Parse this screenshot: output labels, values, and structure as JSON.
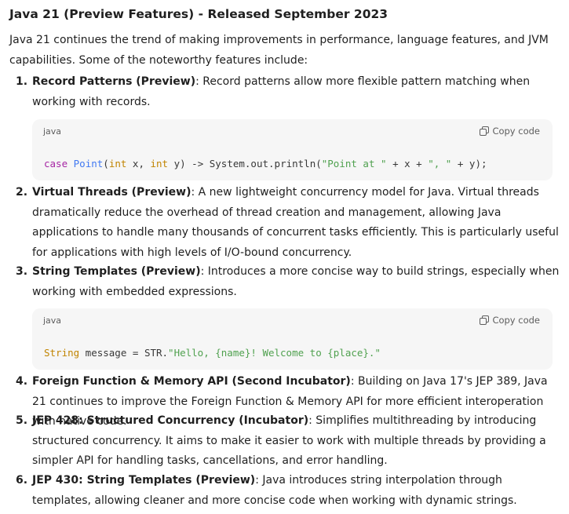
{
  "title": "Java 21 (Preview Features) - Released September 2023",
  "intro": "Java 21 continues the trend of making improvements in performance, language features, and JVM capabilities. Some of the noteworthy features include:",
  "items": [
    {
      "num": "1.",
      "title": "Record Patterns (Preview)",
      "text": ": Record patterns allow more flexible pattern matching when working with records."
    },
    {
      "num": "2.",
      "title": "Virtual Threads (Preview)",
      "text": ": A new lightweight concurrency model for Java. Virtual threads dramatically reduce the overhead of thread creation and management, allowing Java applications to handle many thousands of concurrent tasks efficiently. This is particularly useful for applications with high levels of I/O-bound concurrency."
    },
    {
      "num": "3.",
      "title": "String Templates (Preview)",
      "text": ": Introduces a more concise way to build strings, especially when working with embedded expressions."
    },
    {
      "num": "4.",
      "title": "Foreign Function & Memory API (Second Incubator)",
      "text": ": Building on Java 17's JEP 389, Java 21 continues to improve the Foreign Function & Memory API for more efficient interoperation with native code."
    },
    {
      "num": "5.",
      "title": "JEP 428: Structured Concurrency (Incubator)",
      "text": ": Simplifies multithreading by introducing structured concurrency. It aims to make it easier to work with multiple threads by providing a simpler API for handling tasks, cancellations, and error handling."
    },
    {
      "num": "6.",
      "title": "JEP 430: String Templates (Preview)",
      "text": ": Java introduces string interpolation through templates, allowing cleaner and more concise code when working with dynamic strings."
    }
  ],
  "code_blocks": [
    {
      "lang": "java",
      "copy_label": "Copy code",
      "tokens": {
        "kw_case": "case",
        "cls_point": "Point",
        "p1": "(",
        "ty_int1": "int",
        "p2": " x, ",
        "ty_int2": "int",
        "p3": " y) -> System.out.println(",
        "str1": "\"Point at \"",
        "p4": " + x + ",
        "str2": "\", \"",
        "p5": " + y);"
      }
    },
    {
      "lang": "java",
      "copy_label": "Copy code",
      "tokens": {
        "ty_string": "String",
        "p1": " message = STR.",
        "str1": "\"Hello, {name}! Welcome to {place}.\""
      }
    }
  ],
  "colors": {
    "keyword": "#a626a4",
    "type": "#c18401",
    "class": "#4078f2",
    "string": "#50a14f",
    "code_bg": "#f6f6f6"
  }
}
